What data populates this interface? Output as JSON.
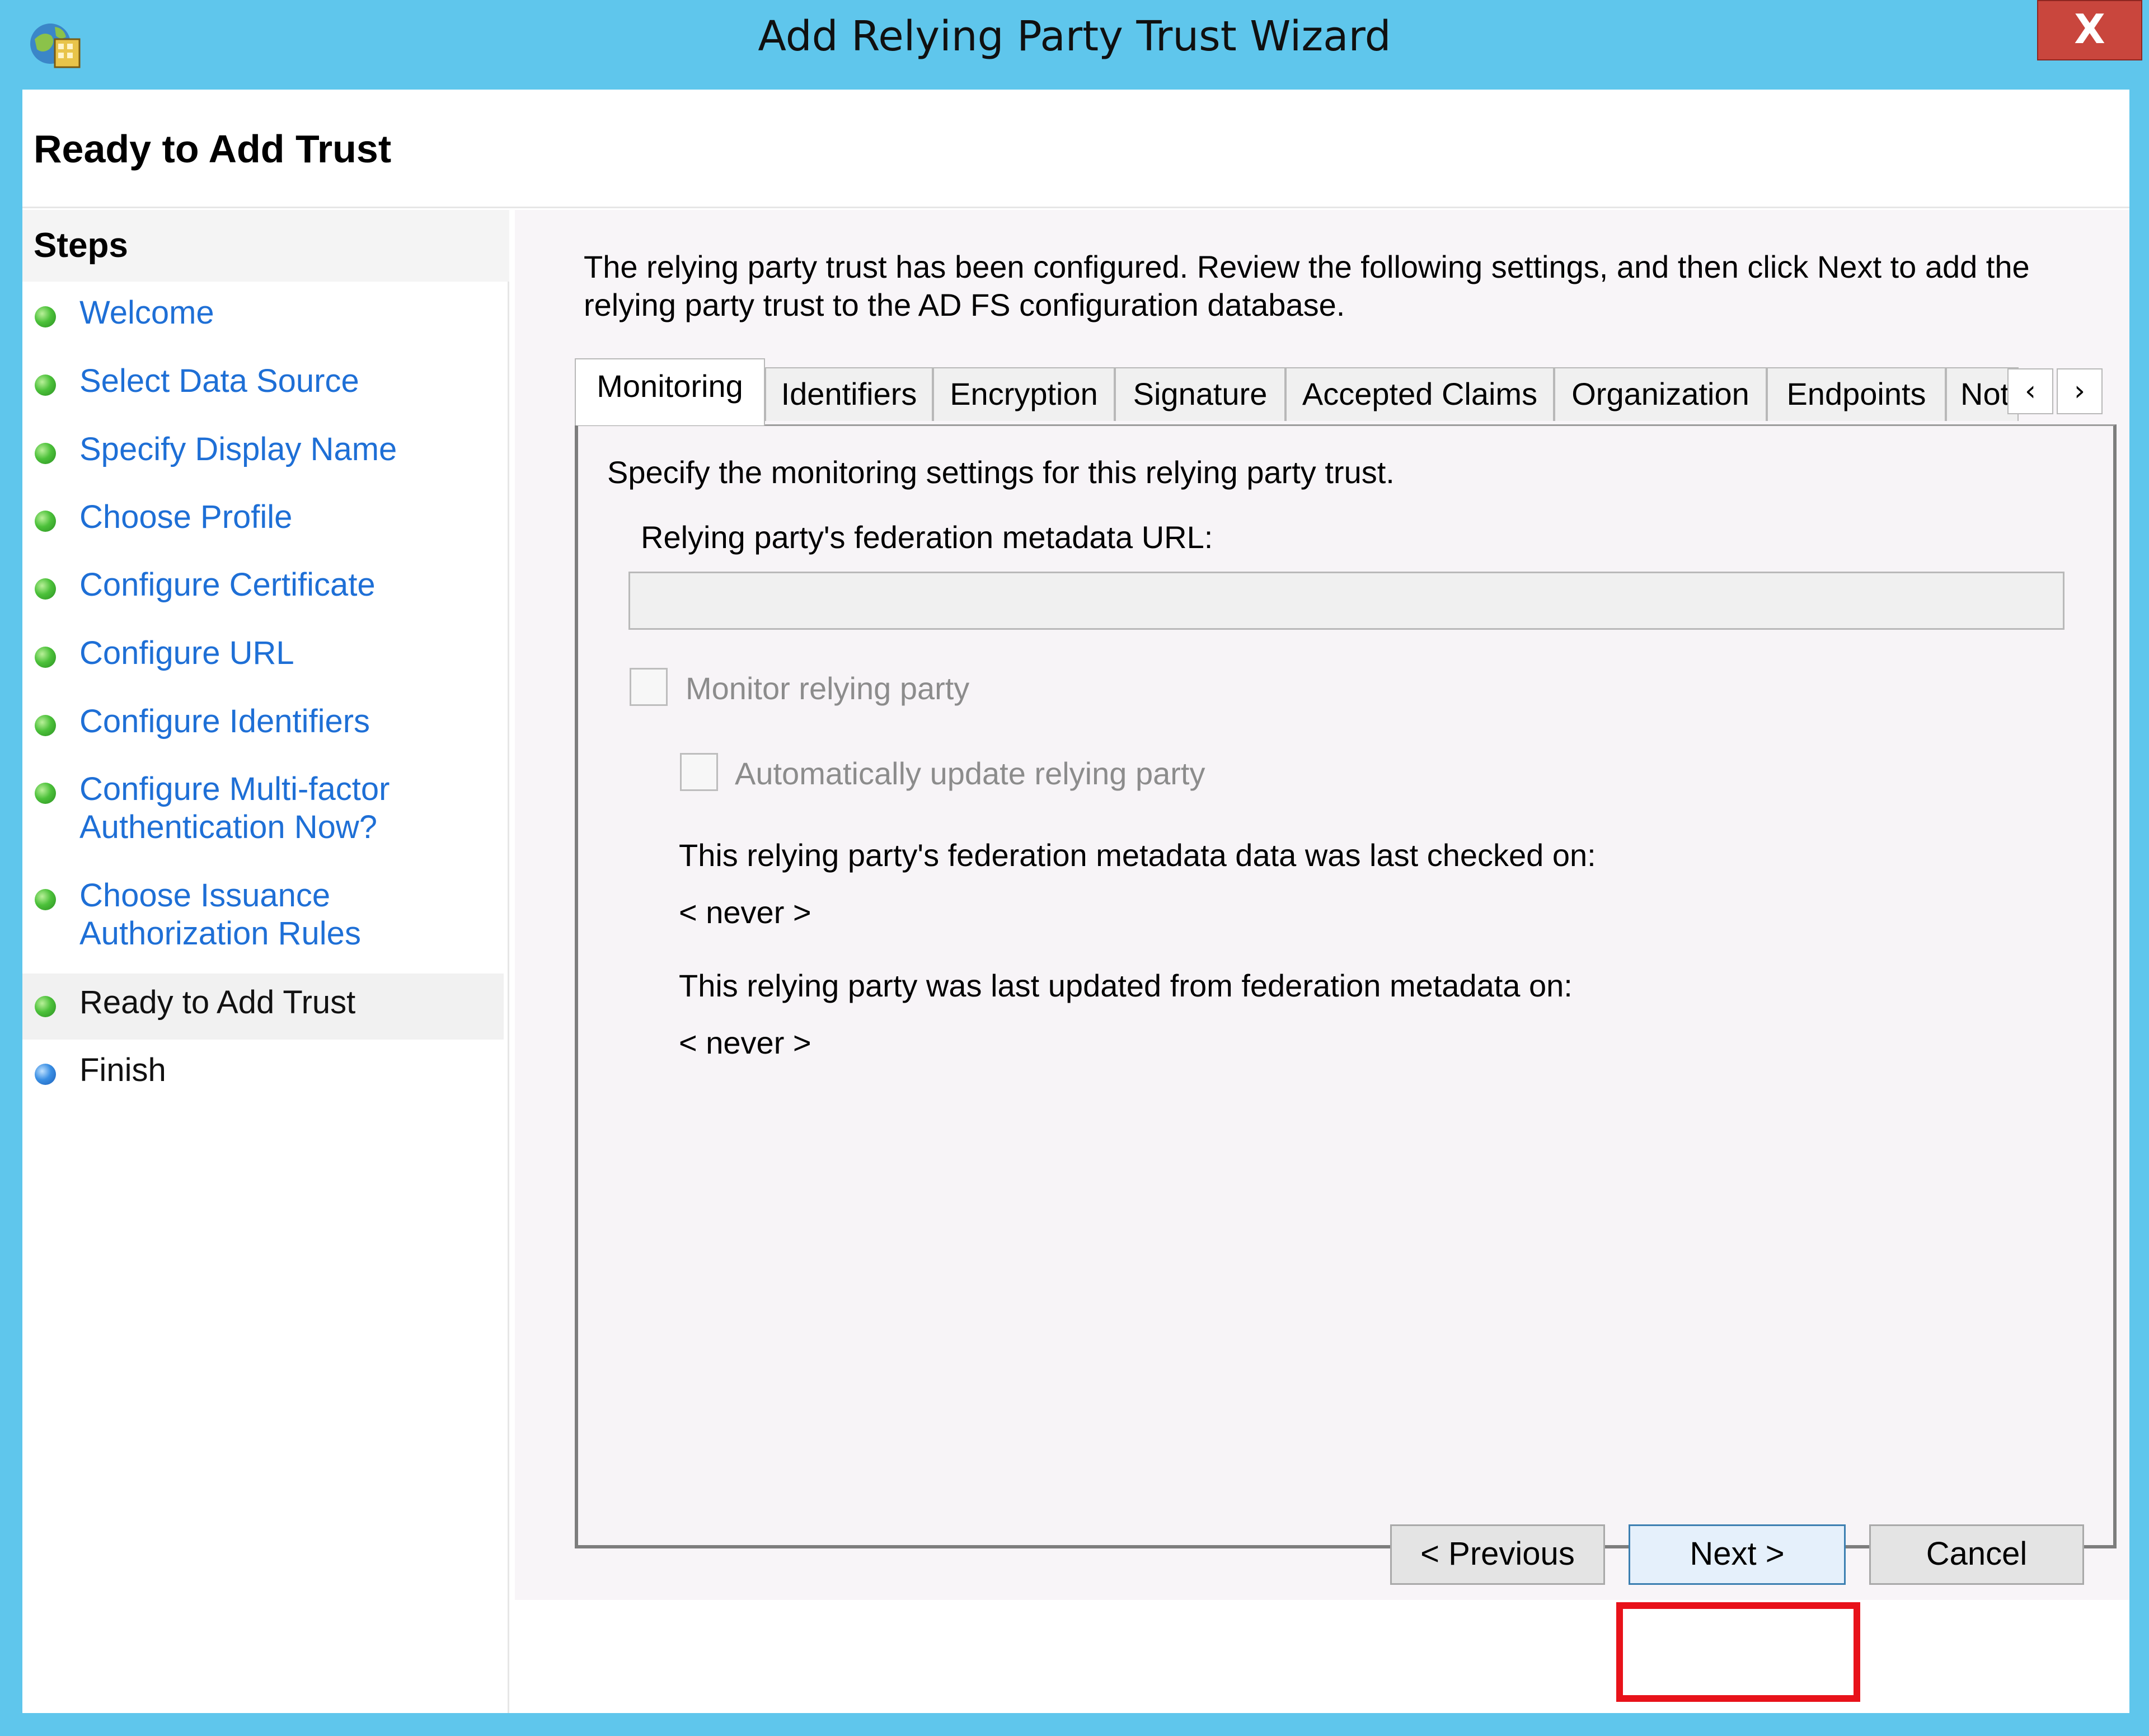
{
  "window": {
    "title": "Add Relying Party Trust Wizard",
    "close_label": "X",
    "page_title": "Ready to Add Trust"
  },
  "steps": {
    "heading": "Steps",
    "items": [
      {
        "label": "Welcome",
        "state": "done"
      },
      {
        "label": "Select Data Source",
        "state": "done"
      },
      {
        "label": "Specify Display Name",
        "state": "done"
      },
      {
        "label": "Choose Profile",
        "state": "done"
      },
      {
        "label": "Configure Certificate",
        "state": "done"
      },
      {
        "label": "Configure URL",
        "state": "done"
      },
      {
        "label": "Configure Identifiers",
        "state": "done"
      },
      {
        "label": "Configure Multi-factor\nAuthentication Now?",
        "state": "done"
      },
      {
        "label": "Choose Issuance\nAuthorization Rules",
        "state": "done"
      },
      {
        "label": "Ready to Add Trust",
        "state": "current"
      },
      {
        "label": "Finish",
        "state": "pending"
      }
    ]
  },
  "content": {
    "intro": "The relying party trust has been configured. Review the following settings, and then click Next to add the relying party trust to the AD FS configuration database.",
    "tabs": [
      "Monitoring",
      "Identifiers",
      "Encryption",
      "Signature",
      "Accepted Claims",
      "Organization",
      "Endpoints",
      "Notes"
    ],
    "tab_scroll_left": "‹",
    "tab_scroll_right": "›",
    "monitoring": {
      "description": "Specify the monitoring settings for this relying party trust.",
      "url_label": "Relying party's federation metadata URL:",
      "url_value": "",
      "monitor_checkbox": "Monitor relying party",
      "auto_update_checkbox": "Automatically update relying party",
      "last_checked_label": "This relying party's federation metadata data was last checked on:",
      "last_checked_value": "< never >",
      "last_updated_label": "This relying party was last updated from federation metadata on:",
      "last_updated_value": "< never >"
    }
  },
  "buttons": {
    "previous": "< Previous",
    "next": "Next >",
    "cancel": "Cancel"
  },
  "colors": {
    "titlebar": "#5fc6ec",
    "link": "#1e6fd6",
    "highlight": "#e8121a",
    "close": "#c9463d"
  }
}
